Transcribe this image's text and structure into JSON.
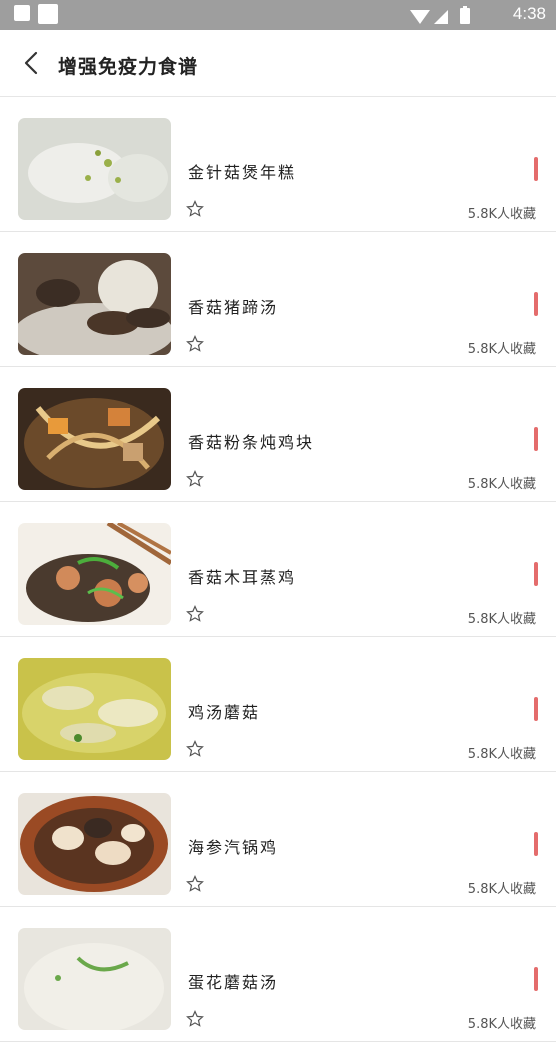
{
  "status_bar": {
    "time": "4:38"
  },
  "header": {
    "title": "增强免疫力食谱"
  },
  "recipes": [
    {
      "name": "金针菇煲年糕",
      "favorites": "5.8K人收藏"
    },
    {
      "name": "香菇猪蹄汤",
      "favorites": "5.8K人收藏"
    },
    {
      "name": "香菇粉条炖鸡块",
      "favorites": "5.8K人收藏"
    },
    {
      "name": "香菇木耳蒸鸡",
      "favorites": "5.8K人收藏"
    },
    {
      "name": "鸡汤蘑菇",
      "favorites": "5.8K人收藏"
    },
    {
      "name": "海参汽锅鸡",
      "favorites": "5.8K人收藏"
    },
    {
      "name": "蛋花蘑菇汤",
      "favorites": "5.8K人收藏"
    }
  ],
  "colors": {
    "status_bar": "#9e9e9e",
    "accent_mark": "#e46c6c"
  }
}
